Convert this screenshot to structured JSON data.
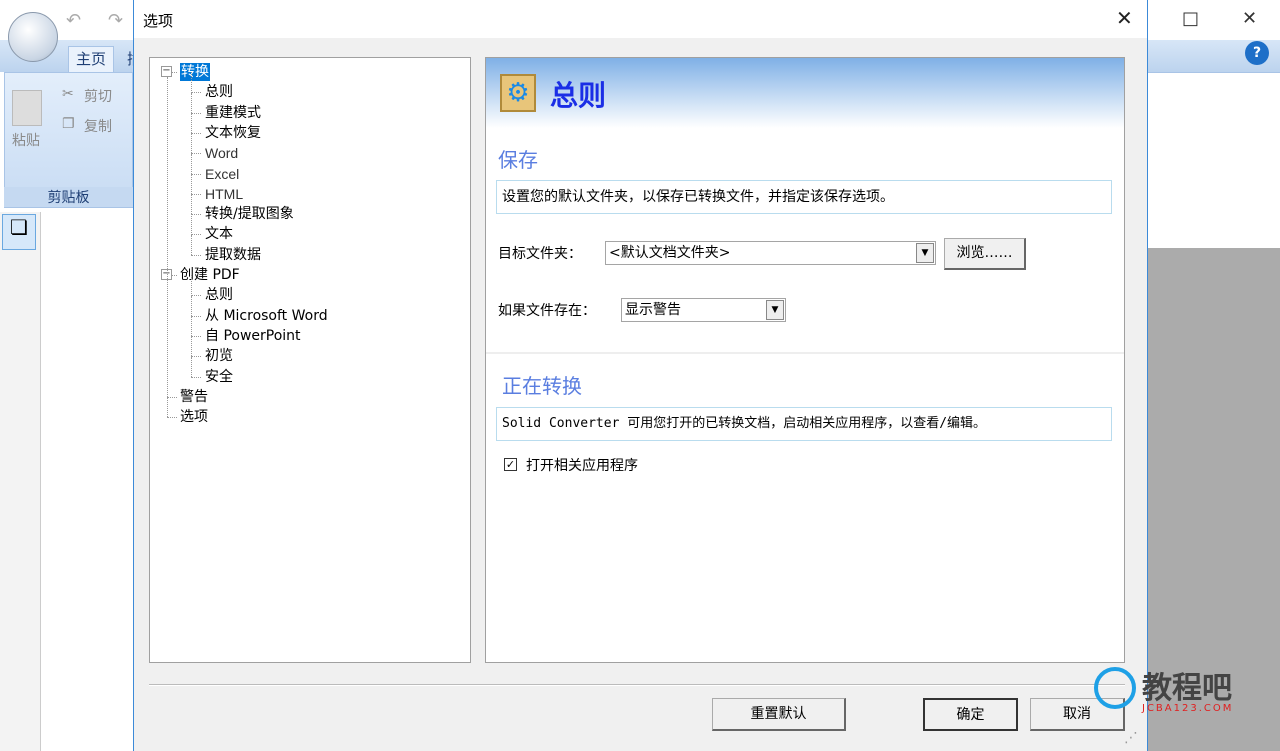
{
  "app": {
    "tab_home": "主页",
    "tab_next": "插",
    "paste": "粘贴",
    "cut": "剪切",
    "copy": "复制",
    "group_clipboard": "剪贴板",
    "maximize": "□",
    "close": "✕",
    "help": "?"
  },
  "dialog": {
    "title": "选项",
    "close": "✕"
  },
  "tree": [
    {
      "label": "转换",
      "level": 0,
      "expanded": true,
      "selected": true
    },
    {
      "label": "总则",
      "level": 1
    },
    {
      "label": "重建模式",
      "level": 1
    },
    {
      "label": "文本恢复",
      "level": 1
    },
    {
      "label": "Word",
      "level": 1
    },
    {
      "label": "Excel",
      "level": 1
    },
    {
      "label": "HTML",
      "level": 1
    },
    {
      "label": "转换/提取图象",
      "level": 1
    },
    {
      "label": "文本",
      "level": 1
    },
    {
      "label": "提取数据",
      "level": 1
    },
    {
      "label": "创建 PDF",
      "level": 0,
      "expanded": true
    },
    {
      "label": "总则",
      "level": 1
    },
    {
      "label": "从 Microsoft Word",
      "level": 1
    },
    {
      "label": "自 PowerPoint",
      "level": 1
    },
    {
      "label": "初览",
      "level": 1
    },
    {
      "label": "安全",
      "level": 1
    },
    {
      "label": "警告",
      "level": 0
    },
    {
      "label": "选项",
      "level": 0
    }
  ],
  "panel": {
    "title": "总则",
    "save": {
      "title": "保存",
      "description": "设置您的默认文件夹，以保存已转换文件，并指定该保存选项。",
      "target_label": "目标文件夹：",
      "target_value": "<默认文档文件夹>",
      "browse": "浏览……",
      "exists_label": "如果文件存在：",
      "exists_value": "显示警告"
    },
    "converting": {
      "title": "正在转换",
      "description": "Solid Converter 可用您打开的已转换文档，启动相关应用程序，以查看/编辑。",
      "open_app_label": "打开相关应用程序",
      "open_app_checked": true
    }
  },
  "buttons": {
    "reset": "重置默认",
    "ok": "确定",
    "cancel": "取消"
  },
  "watermark": {
    "text": "教程吧",
    "url": "JCBA123.COM"
  }
}
